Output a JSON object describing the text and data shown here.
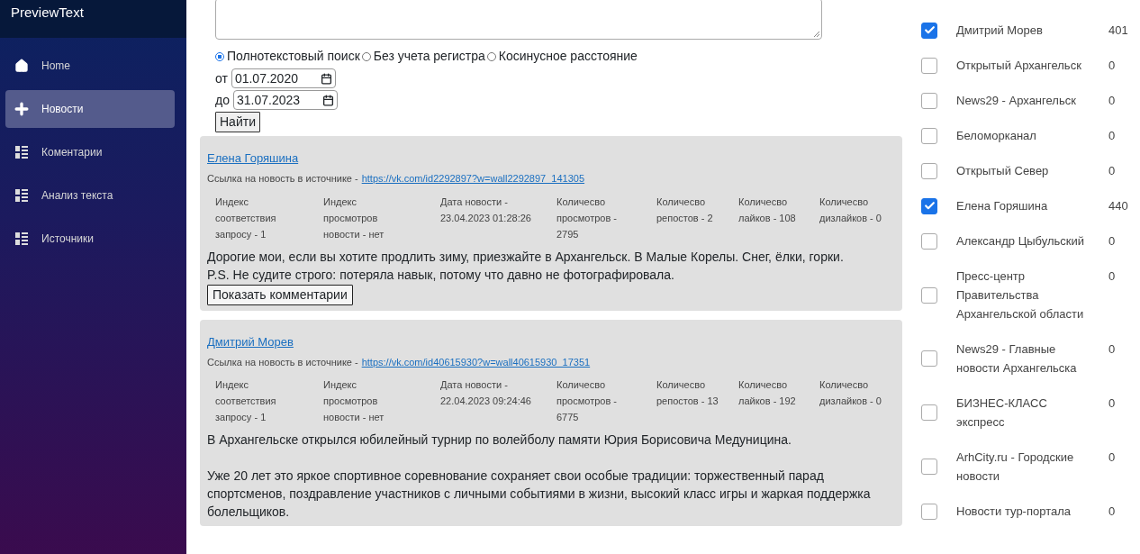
{
  "sidebar": {
    "brand": "PreviewText",
    "items": [
      {
        "label": "Home",
        "kind": "home",
        "selected": false
      },
      {
        "label": "Новости",
        "kind": "add",
        "selected": true
      },
      {
        "label": "Коментарии",
        "kind": "list",
        "selected": false
      },
      {
        "label": "Анализ текста",
        "kind": "list",
        "selected": false
      },
      {
        "label": "Источники",
        "kind": "list",
        "selected": false
      }
    ]
  },
  "search": {
    "modes": [
      {
        "label": "Полнотекстовый поиск",
        "selected": true
      },
      {
        "label": "Без учета регистра",
        "selected": false
      },
      {
        "label": "Косинусное расстояние",
        "selected": false
      }
    ],
    "from_label": "от",
    "from_value": "01.07.2020",
    "to_label": "до",
    "to_value": "31.07.2023",
    "button": "Найти"
  },
  "news": [
    {
      "author": "Елена Горяшина",
      "link_label": "Ссылка на новость в источнике -",
      "link": "https://vk.com/id2292897?w=wall2292897_141305",
      "metrics": [
        "Индекс соответствия запросу - 1",
        "Индекс просмотров новости - нет",
        "Дата новости - 23.04.2023 01:28:26",
        "Количесво просмотров - 2795",
        "Количесво репостов - 2",
        "Количесво лайков - 108",
        "Количесво дизлайков - 0"
      ],
      "paragraphs": [
        "Дорогие мои, если вы хотите продлить зиму, приезжайте в Архангельск. В Малые Корелы. Снег, ёлки, горки.\nP.S. Не судите строго: потеряла навык, потому что давно не фотографировала."
      ],
      "button": "Показать комментарии"
    },
    {
      "author": "Дмитрий Морев",
      "link_label": "Ссылка на новость в источнике -",
      "link": "https://vk.com/id40615930?w=wall40615930_17351",
      "metrics": [
        "Индекс соответствия запросу - 1",
        "Индекс просмотров новости - нет",
        "Дата новости - 22.04.2023 09:24:46",
        "Количесво просмотров - 6775",
        "Количесво репостов - 13",
        "Количесво лайков - 192",
        "Количесво дизлайков - 0"
      ],
      "paragraphs": [
        "В Архангельске открылся юбилейный турнир по волейболу памяти Юрия Борисовича Медуницина.",
        "Уже 20 лет это яркое спортивное соревнование сохраняет свои особые традиции: торжественный парад спортсменов, поздравление участников с личными событиями в жизни, высокий класс игры и жаркая поддержка болельщиков."
      ]
    }
  ],
  "sources": [
    {
      "name": "Дмитрий Морев",
      "count": "401",
      "checked": true
    },
    {
      "name": "Открытый Архангельск",
      "count": "0",
      "checked": false
    },
    {
      "name": "News29 - Архангельск",
      "count": "0",
      "checked": false
    },
    {
      "name": "Беломорканал",
      "count": "0",
      "checked": false
    },
    {
      "name": "Открытый Север",
      "count": "0",
      "checked": false
    },
    {
      "name": "Елена Горяшина",
      "count": "440",
      "checked": true
    },
    {
      "name": "Александр Цыбульский",
      "count": "0",
      "checked": false
    },
    {
      "name": "Пресс-центр Правительства Архангельской области",
      "count": "0",
      "checked": false
    },
    {
      "name": "News29 - Главные новости Архангельска",
      "count": "0",
      "checked": false
    },
    {
      "name": "БИЗНЕС-КЛАСС экспресс",
      "count": "0",
      "checked": false
    },
    {
      "name": "ArhCity.ru - Городские новости",
      "count": "0",
      "checked": false
    },
    {
      "name": "Новости тур-портала",
      "count": "0",
      "checked": false
    }
  ]
}
